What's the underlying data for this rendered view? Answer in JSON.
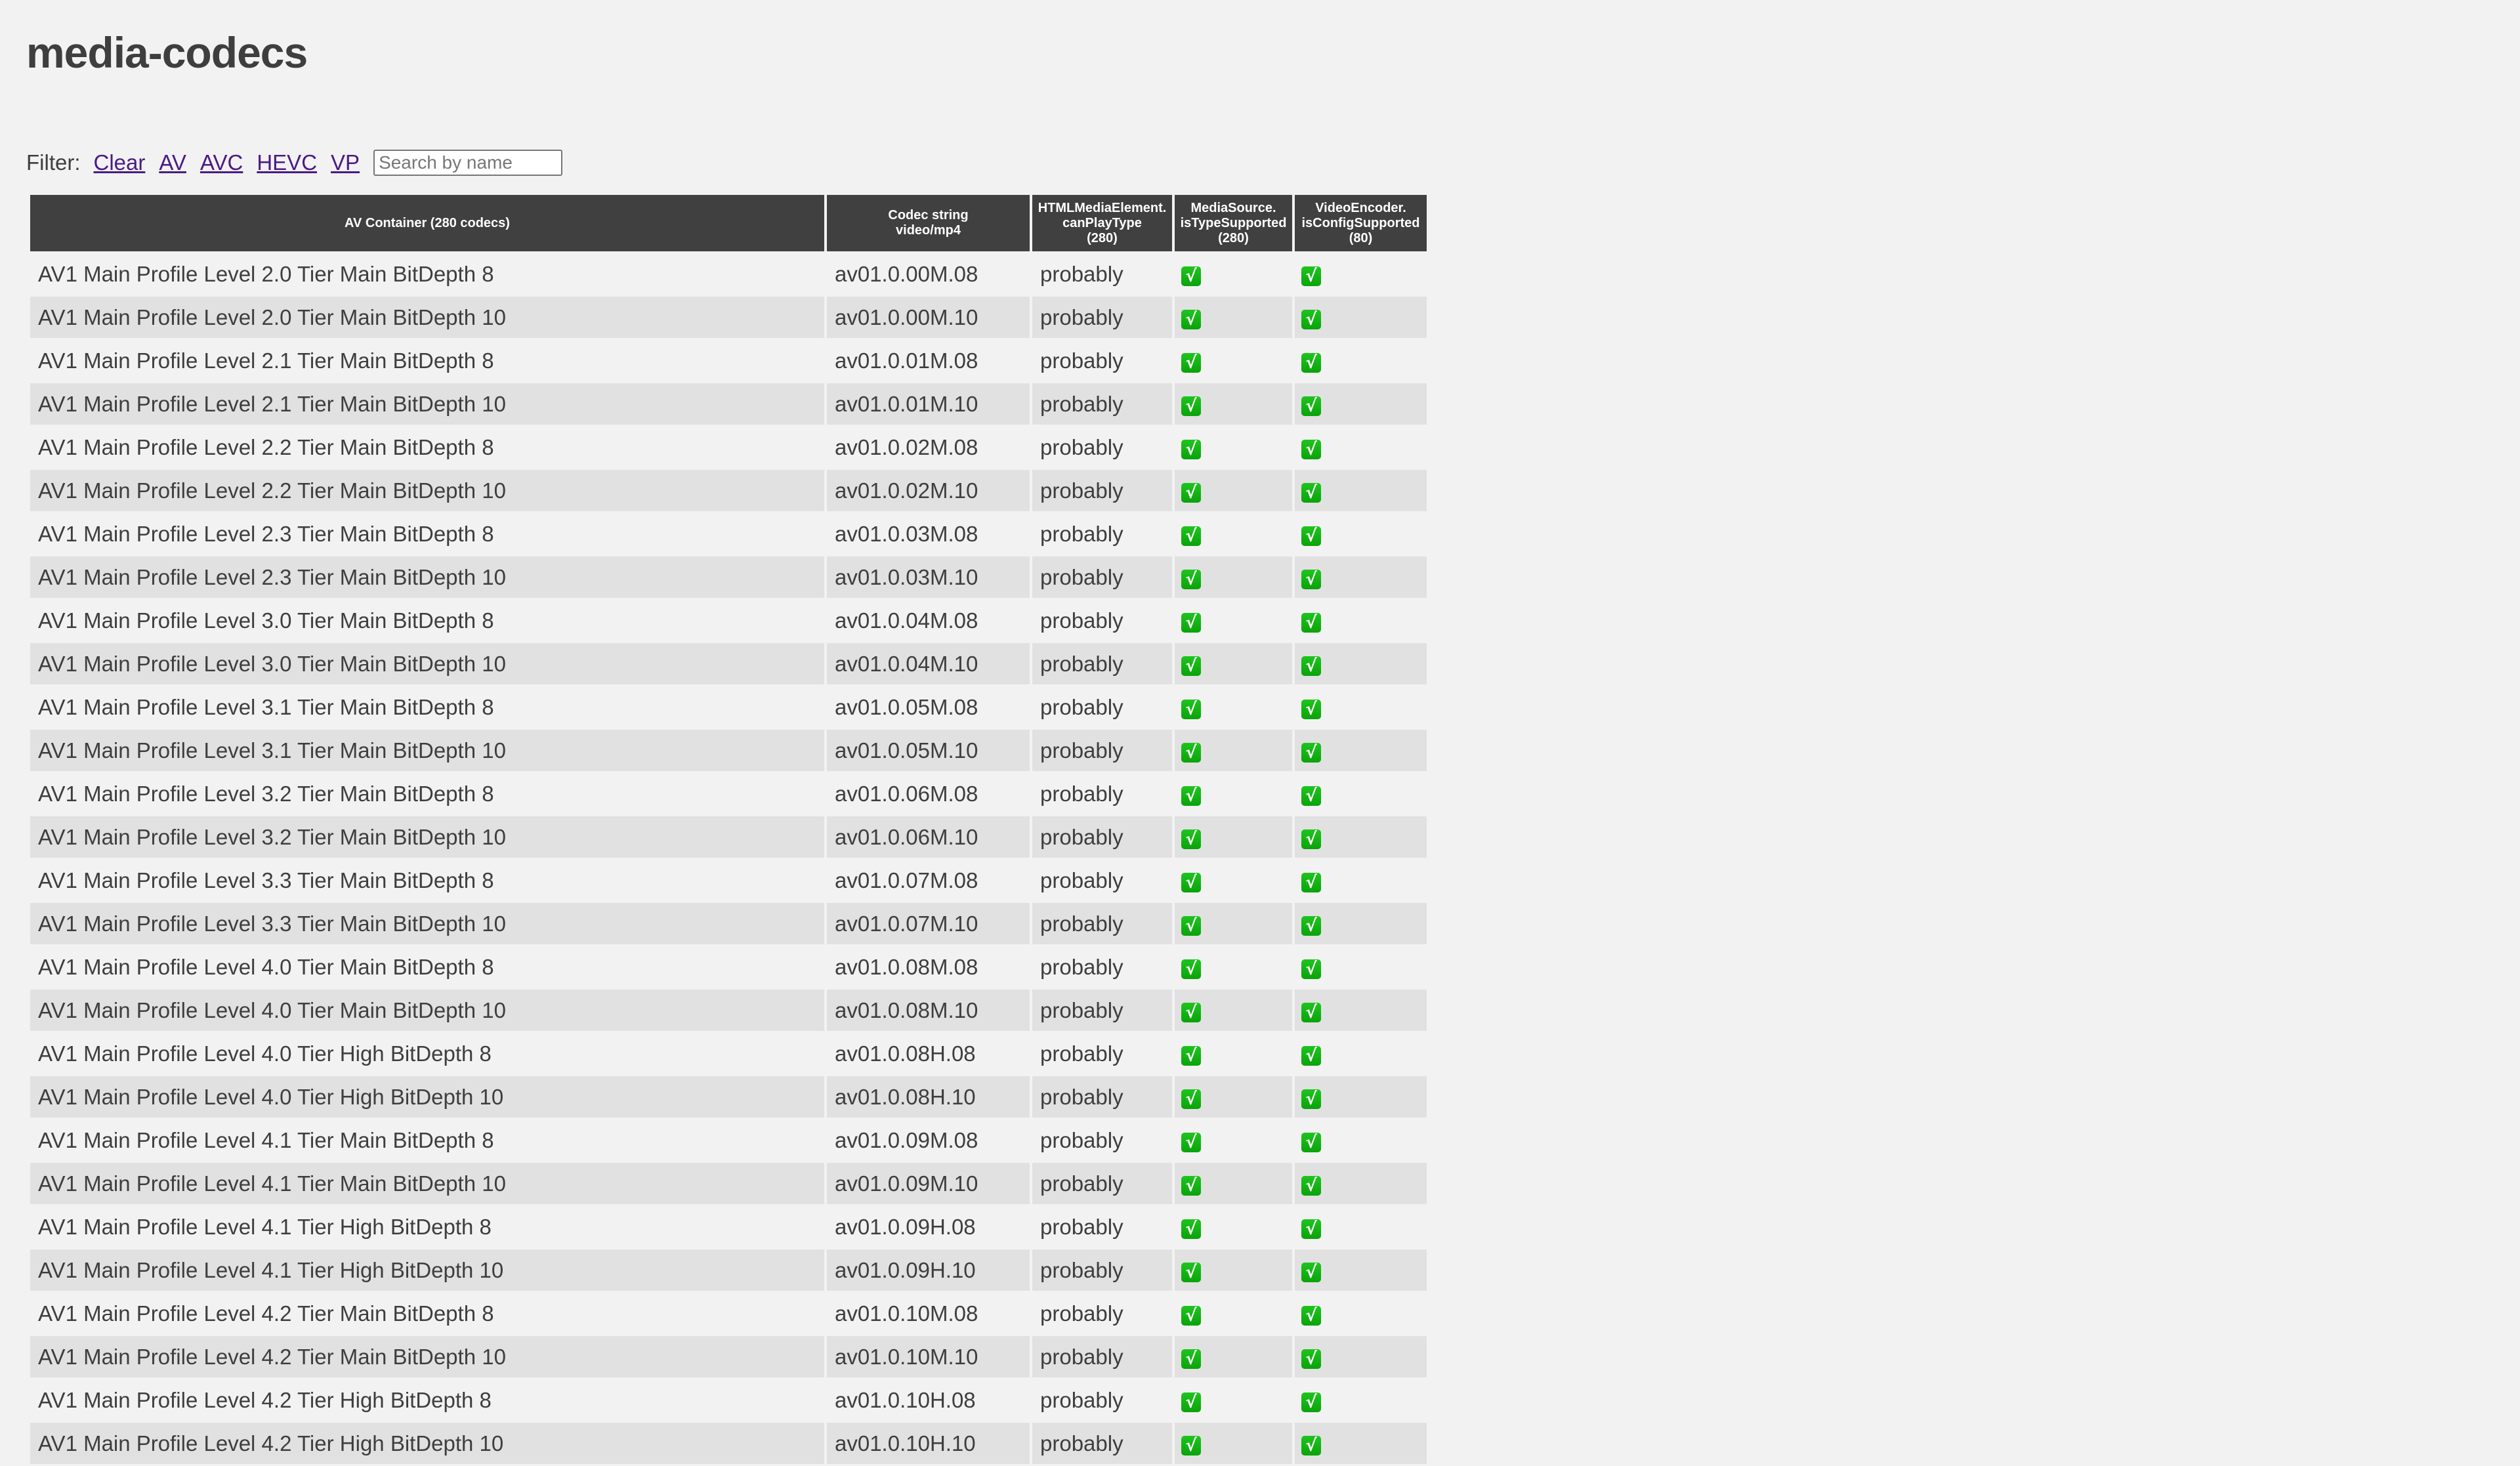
{
  "page": {
    "title": "media-codecs"
  },
  "filter": {
    "label": "Filter:",
    "links": [
      "Clear",
      "AV",
      "AVC",
      "HEVC",
      "VP"
    ],
    "search_value": "",
    "search_placeholder": "Search by name"
  },
  "table": {
    "headers": [
      {
        "lines": [
          "AV Container (280 codecs)"
        ]
      },
      {
        "lines": [
          "Codec string",
          "video/mp4"
        ]
      },
      {
        "lines": [
          "HTMLMediaElement.",
          "canPlayType",
          "(280)"
        ]
      },
      {
        "lines": [
          "MediaSource.",
          "isTypeSupported",
          "(280)"
        ]
      },
      {
        "lines": [
          "VideoEncoder.",
          "isConfigSupported",
          "(80)"
        ]
      }
    ],
    "supported_icon": "check-mark-button-icon",
    "rows": [
      {
        "name": "AV1 Main Profile Level 2.0 Tier Main BitDepth 8",
        "codec": "av01.0.00M.08",
        "canPlayType": "probably",
        "isTypeSupported": true,
        "isConfigSupported": true
      },
      {
        "name": "AV1 Main Profile Level 2.0 Tier Main BitDepth 10",
        "codec": "av01.0.00M.10",
        "canPlayType": "probably",
        "isTypeSupported": true,
        "isConfigSupported": true
      },
      {
        "name": "AV1 Main Profile Level 2.1 Tier Main BitDepth 8",
        "codec": "av01.0.01M.08",
        "canPlayType": "probably",
        "isTypeSupported": true,
        "isConfigSupported": true
      },
      {
        "name": "AV1 Main Profile Level 2.1 Tier Main BitDepth 10",
        "codec": "av01.0.01M.10",
        "canPlayType": "probably",
        "isTypeSupported": true,
        "isConfigSupported": true
      },
      {
        "name": "AV1 Main Profile Level 2.2 Tier Main BitDepth 8",
        "codec": "av01.0.02M.08",
        "canPlayType": "probably",
        "isTypeSupported": true,
        "isConfigSupported": true
      },
      {
        "name": "AV1 Main Profile Level 2.2 Tier Main BitDepth 10",
        "codec": "av01.0.02M.10",
        "canPlayType": "probably",
        "isTypeSupported": true,
        "isConfigSupported": true
      },
      {
        "name": "AV1 Main Profile Level 2.3 Tier Main BitDepth 8",
        "codec": "av01.0.03M.08",
        "canPlayType": "probably",
        "isTypeSupported": true,
        "isConfigSupported": true
      },
      {
        "name": "AV1 Main Profile Level 2.3 Tier Main BitDepth 10",
        "codec": "av01.0.03M.10",
        "canPlayType": "probably",
        "isTypeSupported": true,
        "isConfigSupported": true
      },
      {
        "name": "AV1 Main Profile Level 3.0 Tier Main BitDepth 8",
        "codec": "av01.0.04M.08",
        "canPlayType": "probably",
        "isTypeSupported": true,
        "isConfigSupported": true
      },
      {
        "name": "AV1 Main Profile Level 3.0 Tier Main BitDepth 10",
        "codec": "av01.0.04M.10",
        "canPlayType": "probably",
        "isTypeSupported": true,
        "isConfigSupported": true
      },
      {
        "name": "AV1 Main Profile Level 3.1 Tier Main BitDepth 8",
        "codec": "av01.0.05M.08",
        "canPlayType": "probably",
        "isTypeSupported": true,
        "isConfigSupported": true
      },
      {
        "name": "AV1 Main Profile Level 3.1 Tier Main BitDepth 10",
        "codec": "av01.0.05M.10",
        "canPlayType": "probably",
        "isTypeSupported": true,
        "isConfigSupported": true
      },
      {
        "name": "AV1 Main Profile Level 3.2 Tier Main BitDepth 8",
        "codec": "av01.0.06M.08",
        "canPlayType": "probably",
        "isTypeSupported": true,
        "isConfigSupported": true
      },
      {
        "name": "AV1 Main Profile Level 3.2 Tier Main BitDepth 10",
        "codec": "av01.0.06M.10",
        "canPlayType": "probably",
        "isTypeSupported": true,
        "isConfigSupported": true
      },
      {
        "name": "AV1 Main Profile Level 3.3 Tier Main BitDepth 8",
        "codec": "av01.0.07M.08",
        "canPlayType": "probably",
        "isTypeSupported": true,
        "isConfigSupported": true
      },
      {
        "name": "AV1 Main Profile Level 3.3 Tier Main BitDepth 10",
        "codec": "av01.0.07M.10",
        "canPlayType": "probably",
        "isTypeSupported": true,
        "isConfigSupported": true
      },
      {
        "name": "AV1 Main Profile Level 4.0 Tier Main BitDepth 8",
        "codec": "av01.0.08M.08",
        "canPlayType": "probably",
        "isTypeSupported": true,
        "isConfigSupported": true
      },
      {
        "name": "AV1 Main Profile Level 4.0 Tier Main BitDepth 10",
        "codec": "av01.0.08M.10",
        "canPlayType": "probably",
        "isTypeSupported": true,
        "isConfigSupported": true
      },
      {
        "name": "AV1 Main Profile Level 4.0 Tier High BitDepth 8",
        "codec": "av01.0.08H.08",
        "canPlayType": "probably",
        "isTypeSupported": true,
        "isConfigSupported": true
      },
      {
        "name": "AV1 Main Profile Level 4.0 Tier High BitDepth 10",
        "codec": "av01.0.08H.10",
        "canPlayType": "probably",
        "isTypeSupported": true,
        "isConfigSupported": true
      },
      {
        "name": "AV1 Main Profile Level 4.1 Tier Main BitDepth 8",
        "codec": "av01.0.09M.08",
        "canPlayType": "probably",
        "isTypeSupported": true,
        "isConfigSupported": true
      },
      {
        "name": "AV1 Main Profile Level 4.1 Tier Main BitDepth 10",
        "codec": "av01.0.09M.10",
        "canPlayType": "probably",
        "isTypeSupported": true,
        "isConfigSupported": true
      },
      {
        "name": "AV1 Main Profile Level 4.1 Tier High BitDepth 8",
        "codec": "av01.0.09H.08",
        "canPlayType": "probably",
        "isTypeSupported": true,
        "isConfigSupported": true
      },
      {
        "name": "AV1 Main Profile Level 4.1 Tier High BitDepth 10",
        "codec": "av01.0.09H.10",
        "canPlayType": "probably",
        "isTypeSupported": true,
        "isConfigSupported": true
      },
      {
        "name": "AV1 Main Profile Level 4.2 Tier Main BitDepth 8",
        "codec": "av01.0.10M.08",
        "canPlayType": "probably",
        "isTypeSupported": true,
        "isConfigSupported": true
      },
      {
        "name": "AV1 Main Profile Level 4.2 Tier Main BitDepth 10",
        "codec": "av01.0.10M.10",
        "canPlayType": "probably",
        "isTypeSupported": true,
        "isConfigSupported": true
      },
      {
        "name": "AV1 Main Profile Level 4.2 Tier High BitDepth 8",
        "codec": "av01.0.10H.08",
        "canPlayType": "probably",
        "isTypeSupported": true,
        "isConfigSupported": true
      },
      {
        "name": "AV1 Main Profile Level 4.2 Tier High BitDepth 10",
        "codec": "av01.0.10H.10",
        "canPlayType": "probably",
        "isTypeSupported": true,
        "isConfigSupported": true
      }
    ]
  },
  "colors": {
    "link": "#4b1a85",
    "header_bg": "#404040",
    "row_alt": "#e1e1e1",
    "check": "#0fb40f"
  }
}
